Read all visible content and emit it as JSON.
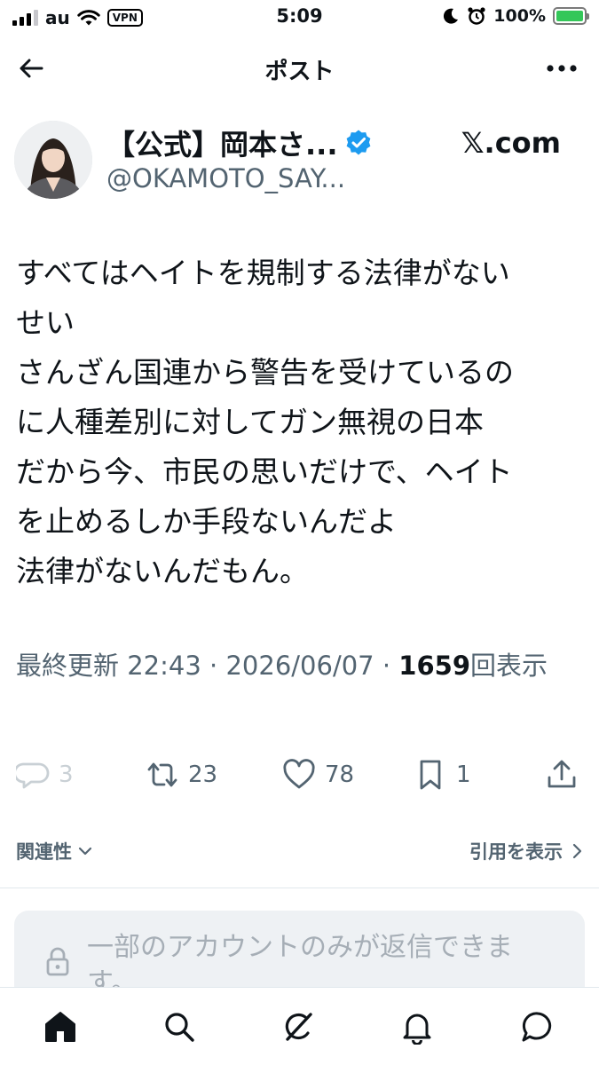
{
  "status_bar": {
    "carrier": "au",
    "vpn": "VPN",
    "time": "5:09",
    "battery_pct": "100%"
  },
  "header": {
    "title": "ポスト"
  },
  "author": {
    "name": "【公式】岡本さ...",
    "handle": "@OKAMOTO_SAY...",
    "source": "𝕏.com"
  },
  "post": {
    "text": "すべてはヘイトを規制する法律がない\nせい\nさんざん国連から警告を受けているの\nに人種差別に対してガン無視の日本\nだから今、市民の思いだけで、ヘイト\nを止めるしか手段ないんだよ\n法律がないんだもん。"
  },
  "meta": {
    "updated_label": "最終更新",
    "time": "22:43",
    "sep1": " · ",
    "date": "2026/06/07",
    "sep2": " · ",
    "views": "1659",
    "views_label": "回表示"
  },
  "actions": {
    "reply_count": "3",
    "repost_count": "23",
    "like_count": "78",
    "bookmark_count": "1"
  },
  "related": {
    "sort_label": "関連性",
    "quotes_label": "引用を表示"
  },
  "reply_restriction": {
    "text": "一部のアカウントのみが返信できます。"
  },
  "icons": {
    "back": "arrow-left-icon",
    "more": "more-horizontal-icon",
    "verified": "verified-badge-icon",
    "reply": "speech-bubble-icon",
    "repost": "repost-icon",
    "like": "heart-icon",
    "bookmark": "bookmark-icon",
    "share": "share-icon",
    "lock": "lock-icon",
    "home": "home-icon",
    "search": "search-icon",
    "grok": "grok-icon",
    "notifications": "bell-icon",
    "messages": "message-icon"
  },
  "colors": {
    "text": "#0f1419",
    "secondary": "#536471",
    "verified": "#1d9bf0",
    "battery": "#34c759"
  }
}
